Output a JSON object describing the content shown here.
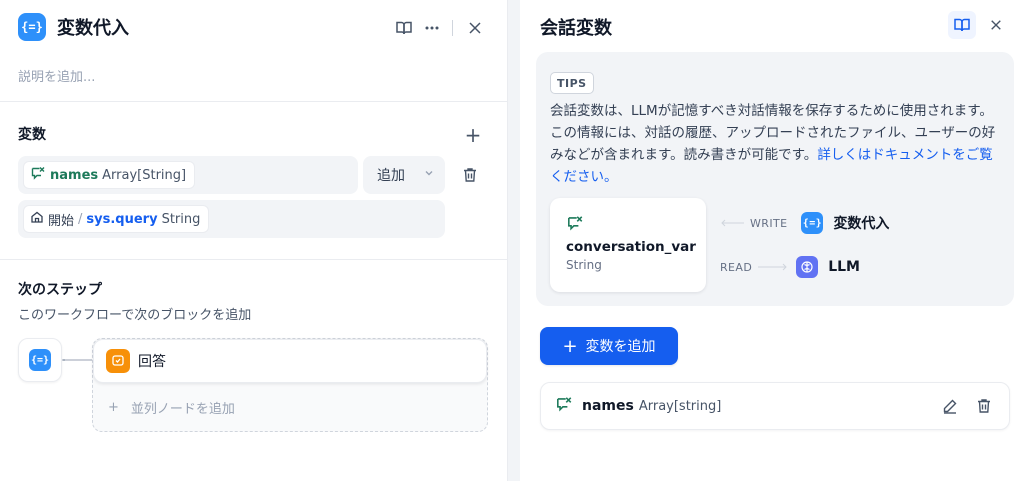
{
  "left_panel": {
    "title": "変数代入",
    "node_icon_glyph": "{=}",
    "description_placeholder": "説明を追加...",
    "variables_section": {
      "title": "変数",
      "assigned_var": {
        "name": "names",
        "type": "Array[String]"
      },
      "operation": "追加",
      "value_source": {
        "node": "開始",
        "separator": "/",
        "var": "sys.query",
        "type": "String"
      }
    },
    "next_step": {
      "title": "次のステップ",
      "subtitle": "このワークフローで次のブロックを追加",
      "next_node": "回答",
      "add_parallel": "並列ノードを追加",
      "add_parallel_plus": "+"
    }
  },
  "right_panel": {
    "title": "会話変数",
    "tips": {
      "badge": "TIPS",
      "text": "会話変数は、LLMが記憶すべき対話情報を保存するために使用されます。この情報には、対話の履歴、アップロードされたファイル、ユーザーの好みなどが含まれます。読み書きが可能です。",
      "link": "詳しくはドキュメントをご覧ください。",
      "card": {
        "name": "conversation_var",
        "type": "String"
      },
      "write_label": "WRITE",
      "write_target": "変数代入",
      "read_label": "READ",
      "read_target": "LLM"
    },
    "add_button": {
      "plus": "+",
      "label": "変数を追加"
    },
    "variable_item": {
      "name": "names",
      "type": "Array[string]"
    }
  },
  "colors": {
    "primary": "#155eef",
    "node_blue": "#2e90fa",
    "answer_orange": "#f79009",
    "llm_indigo": "#6172f3",
    "var_green": "#1d7a5a"
  },
  "icons": [
    "book-icon",
    "more-icon",
    "close-icon",
    "plus-icon",
    "conversation-var-icon",
    "chevron-down-icon",
    "trash-icon",
    "home-icon",
    "answer-icon",
    "llm-icon",
    "edit-icon",
    "assigner-icon"
  ]
}
